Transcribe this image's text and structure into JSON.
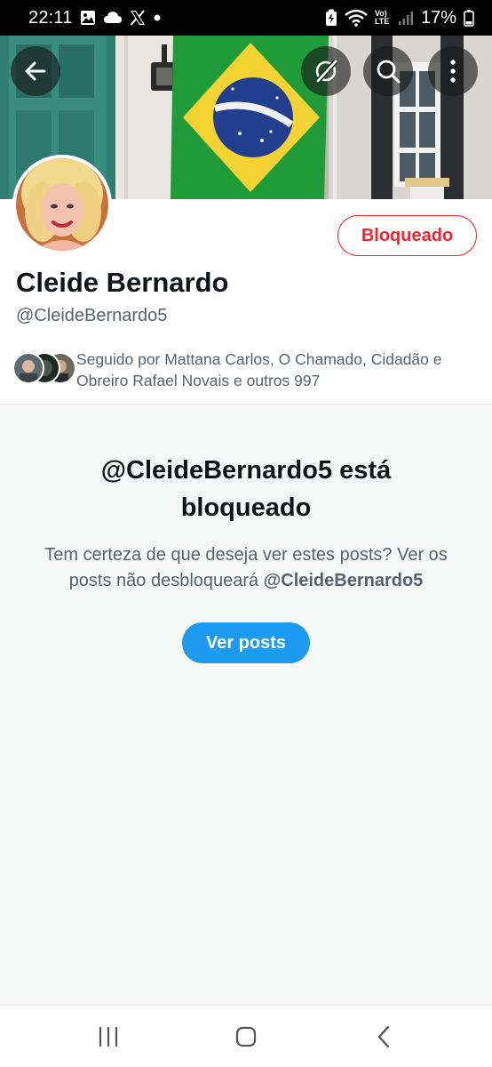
{
  "status_bar": {
    "time": "22:11",
    "battery": "17%",
    "net_label": "Vo) LTE",
    "icons": [
      "image-icon",
      "cloud-icon",
      "x-app-icon",
      "dot-icon",
      "battery-saver-icon",
      "wifi-icon",
      "signal-icon",
      "battery-icon"
    ]
  },
  "header": {
    "icons": [
      "back-arrow-icon",
      "no-sync-icon",
      "search-icon",
      "more-vertical-icon"
    ]
  },
  "profile": {
    "blocked_label": "Bloqueado",
    "name": "Cleide Bernardo",
    "handle": "@CleideBernardo5",
    "followers_text": "Seguido por Mattana Carlos, O Chamado, Cidadão e Obreiro Rafael Novais e outros 997"
  },
  "blocked_notice": {
    "title": "@CleideBernardo5 está bloqueado",
    "description": "Tem certeza de que deseja ver estes posts? Ver os posts não desbloqueará",
    "description_handle": "@CleideBernardo5",
    "button_label": "Ver posts"
  },
  "nav": {
    "icons": [
      "recent-apps-icon",
      "home-icon",
      "back-icon"
    ]
  },
  "colors": {
    "accent_blue": "#1d9bf0",
    "blocked_red": "#f4212e",
    "text_primary": "#0f1419",
    "text_secondary": "#536471",
    "panel_bg": "#f7f9f9"
  }
}
